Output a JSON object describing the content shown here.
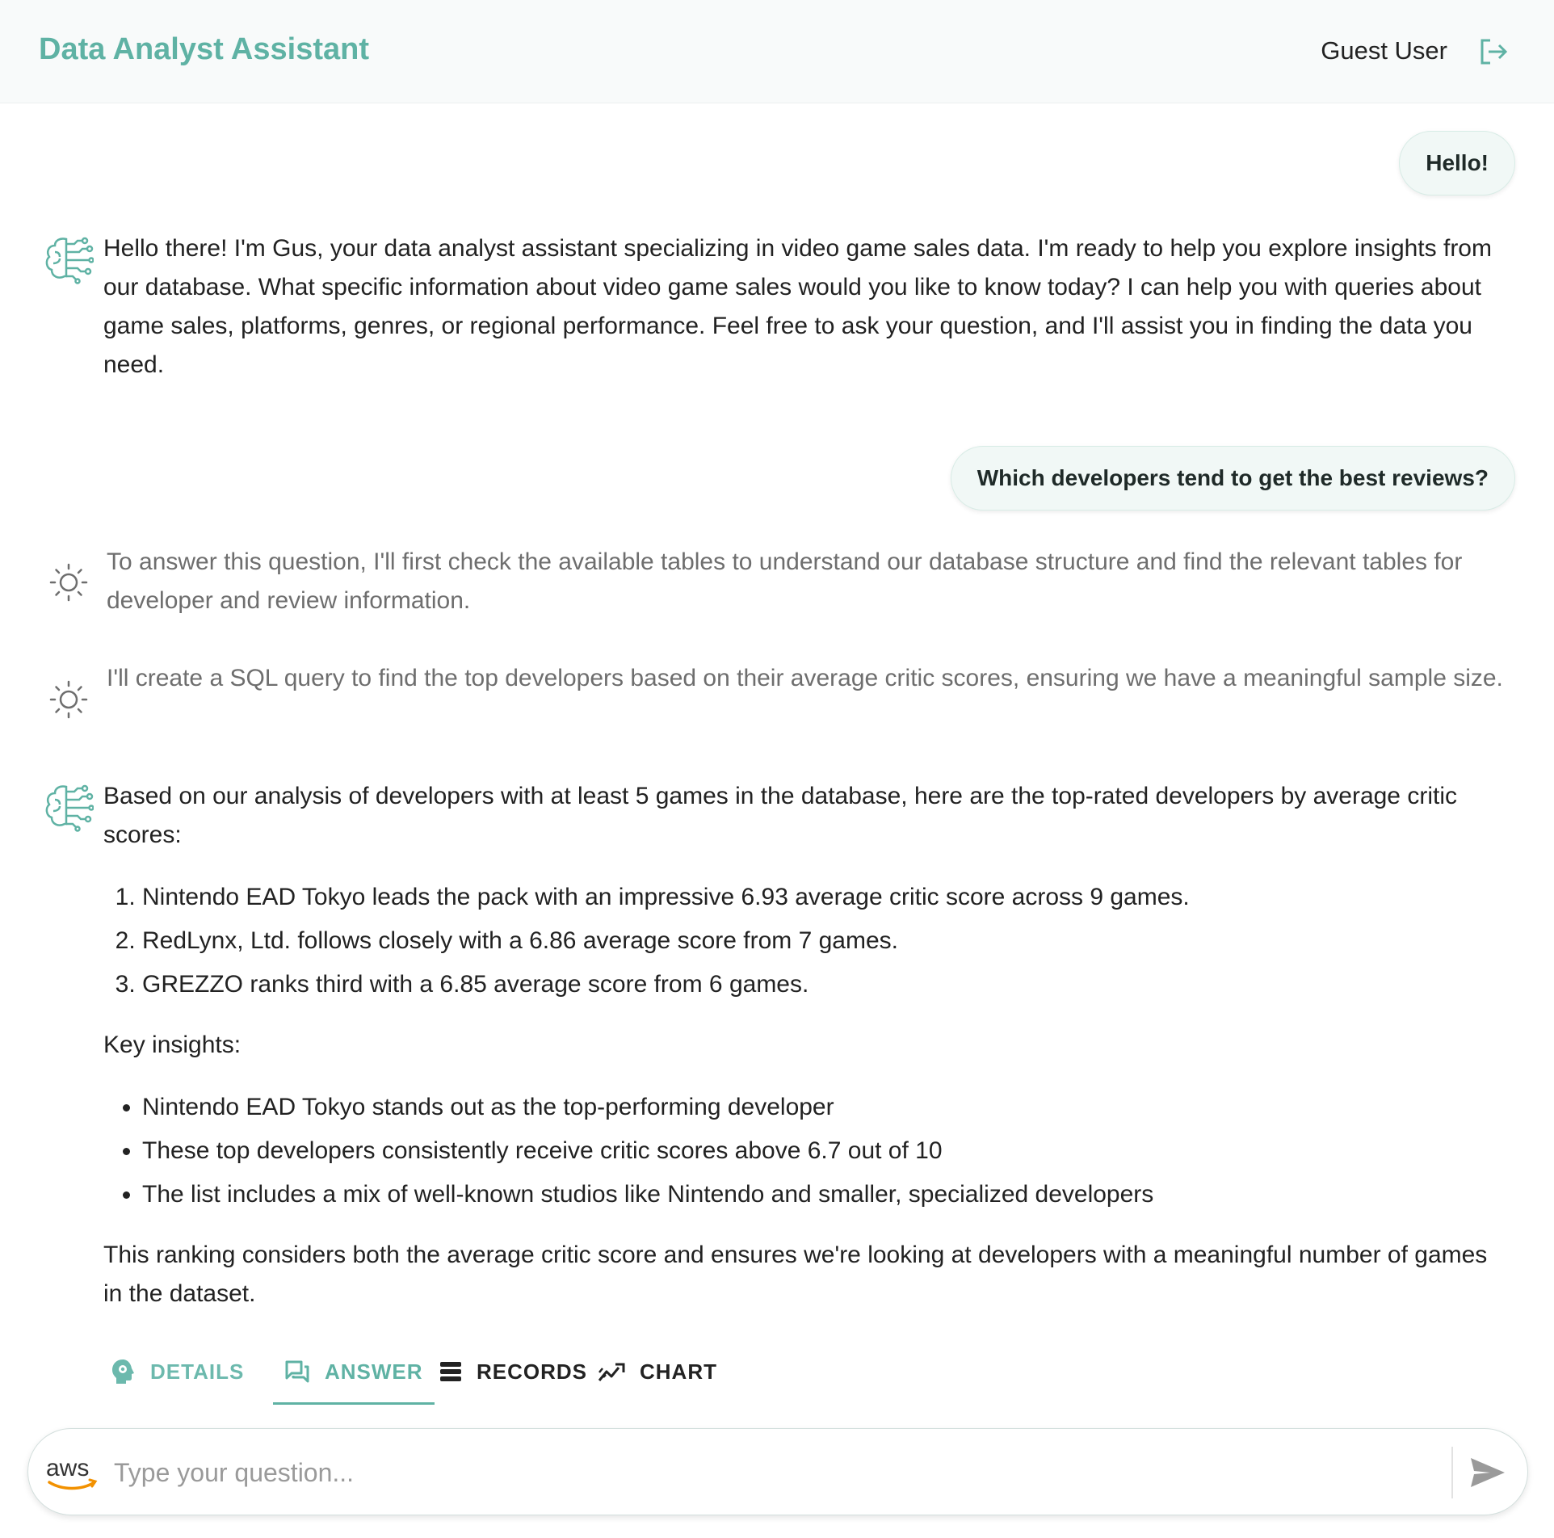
{
  "header": {
    "title": "Data Analyst Assistant",
    "user_name": "Guest User"
  },
  "conversation": {
    "user_message_1": "Hello!",
    "assistant_message_1": "Hello there! I'm Gus, your data analyst assistant specializing in video game sales data. I'm ready to help you explore insights from our database. What specific information about video game sales would you like to know today? I can help you with queries about game sales, platforms, genres, or regional performance. Feel free to ask your question, and I'll assist you in finding the data you need.",
    "user_message_2": "Which developers tend to get the best reviews?",
    "thinking_1": "To answer this question, I'll first check the available tables to understand our database structure and find the relevant tables for developer and review information.",
    "thinking_2": "I'll create a SQL query to find the top developers based on their average critic scores, ensuring we have a meaningful sample size.",
    "answer": {
      "intro": "Based on our analysis of developers with at least 5 games in the database, here are the top-rated developers by average critic scores:",
      "steps": [
        "Nintendo EAD Tokyo leads the pack with an impressive 6.93 average critic score across 9 games.",
        "RedLynx, Ltd. follows closely with a 6.86 average score from 7 games.",
        "GREZZO ranks third with a 6.85 average score from 6 games."
      ],
      "insights_heading": "Key insights:",
      "insights": [
        "Nintendo EAD Tokyo stands out as the top-performing developer",
        "These top developers consistently receive critic scores above 6.7 out of 10",
        "The list includes a mix of well-known studios like Nintendo and smaller, specialized developers"
      ],
      "conclusion": "This ranking considers both the average critic score and ensures we're looking at developers with a meaningful number of games in the dataset."
    }
  },
  "tabs": {
    "details": "DETAILS",
    "answer": "ANSWER",
    "records": "RECORDS",
    "chart": "CHART",
    "selected": "answer"
  },
  "input": {
    "placeholder": "Type your question...",
    "value": "",
    "logo_text": "aws"
  },
  "colors": {
    "accent": "#5fb2a4",
    "bubble_bg": "#f1f8f6",
    "thinking_text": "#6e6e6e",
    "aws_orange": "#f29100"
  },
  "icons": {
    "logout": "logout-icon",
    "assistant": "brain-circuit-icon",
    "thinking": "lightbulb-icon",
    "details": "brain-gear-icon",
    "answer": "chat-bubbles-icon",
    "records": "list-icon",
    "chart": "line-chart-icon",
    "send": "send-icon"
  }
}
